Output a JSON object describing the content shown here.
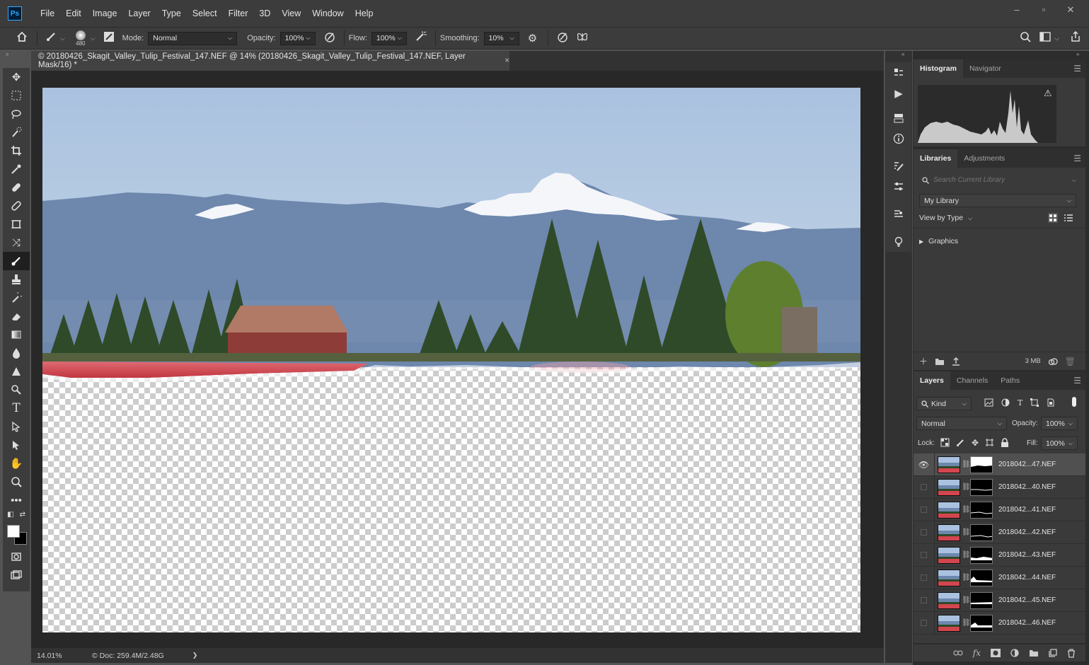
{
  "app": {
    "logo": "Ps",
    "menu": [
      "File",
      "Edit",
      "Image",
      "Layer",
      "Type",
      "Select",
      "Filter",
      "3D",
      "View",
      "Window",
      "Help"
    ],
    "window_controls": [
      "–",
      "▫",
      "✕"
    ]
  },
  "options": {
    "brush_size": "480",
    "mode_label": "Mode:",
    "mode_value": "Normal",
    "opacity_label": "Opacity:",
    "opacity_value": "100%",
    "flow_label": "Flow:",
    "flow_value": "100%",
    "smoothing_label": "Smoothing:",
    "smoothing_value": "10%"
  },
  "document": {
    "tab_title": "© 20180426_Skagit_Valley_Tulip_Festival_147.NEF @ 14% (20180426_Skagit_Valley_Tulip_Festival_147.NEF, Layer Mask/16) *",
    "tab_close": "×",
    "zoom": "14.01%",
    "doc_info": "© Doc: 259.4M/2.48G",
    "status_arrow": "❯"
  },
  "histogram_panel": {
    "tabs": [
      "Histogram",
      "Navigator"
    ],
    "warning": "⚠"
  },
  "libraries_panel": {
    "tabs": [
      "Libraries",
      "Adjustments"
    ],
    "search_placeholder": "Search Current Library",
    "library_name": "My Library",
    "view_by": "View by Type",
    "group": "Graphics",
    "size": "3 MB"
  },
  "layers_panel": {
    "tabs": [
      "Layers",
      "Channels",
      "Paths"
    ],
    "filter_kind": "Kind",
    "blend_mode": "Normal",
    "opacity_label": "Opacity:",
    "opacity_value": "100%",
    "lock_label": "Lock:",
    "fill_label": "Fill:",
    "fill_value": "100%",
    "layers": [
      {
        "name": "2018042...47.NEF",
        "visible": true,
        "selected": true
      },
      {
        "name": "2018042...40.NEF",
        "visible": false,
        "selected": false
      },
      {
        "name": "2018042...41.NEF",
        "visible": false,
        "selected": false
      },
      {
        "name": "2018042...42.NEF",
        "visible": false,
        "selected": false
      },
      {
        "name": "2018042...43.NEF",
        "visible": false,
        "selected": false
      },
      {
        "name": "2018042...44.NEF",
        "visible": false,
        "selected": false
      },
      {
        "name": "2018042...45.NEF",
        "visible": false,
        "selected": false
      },
      {
        "name": "2018042...46.NEF",
        "visible": false,
        "selected": false
      }
    ]
  },
  "colors": {
    "sky_top": "#aac2e0",
    "sky_bottom": "#c4d4e4",
    "mountain": "#6d87ad",
    "snow": "#f4f6fa",
    "tree": "#2f4a28",
    "barn": "#8e3c38",
    "barn_roof": "#b07a66",
    "tulip": "#d3454f"
  }
}
